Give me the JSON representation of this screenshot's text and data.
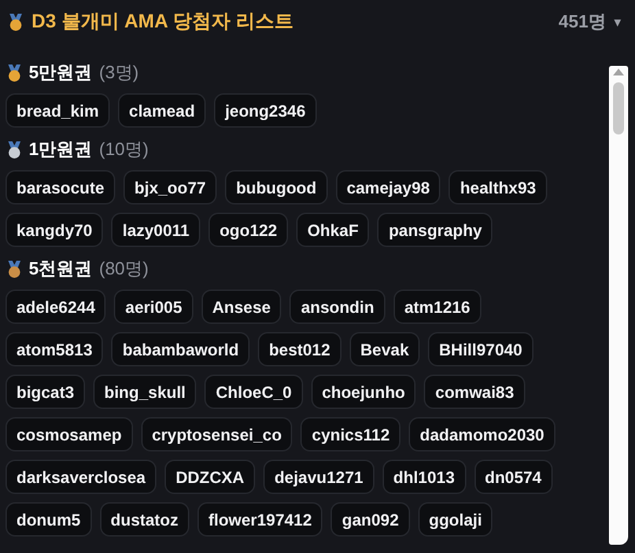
{
  "header": {
    "title": "D3 불개미 AMA 당첨자 리스트",
    "count": "451명",
    "caret": "▾"
  },
  "sections": [
    {
      "title": "5만원권",
      "count": "(3명)",
      "color": "#e5a437",
      "winners": [
        "bread_kim",
        "clamead",
        "jeong2346"
      ]
    },
    {
      "title": "1만원권",
      "count": "(10명)",
      "color": "#c7ccd3",
      "winners": [
        "barasocute",
        "bjx_oo77",
        "bubugood",
        "camejay98",
        "healthx93",
        "kangdy70",
        "lazy0011",
        "ogo122",
        "OhkaF",
        "pansgraphy"
      ]
    },
    {
      "title": "5천원권",
      "count": "(80명)",
      "color": "#c98e47",
      "winners": [
        "adele6244",
        "aeri005",
        "Ansese",
        "ansondin",
        "atm1216",
        "atom5813",
        "babambaworld",
        "best012",
        "Bevak",
        "BHill97040",
        "bigcat3",
        "bing_skull",
        "ChloeC_0",
        "choejunho",
        "comwai83",
        "cosmosamep",
        "cryptosensei_co",
        "cynics112",
        "dadamomo2030",
        "darksaverclosea",
        "DDZCXA",
        "dejavu1271",
        "dhl1013",
        "dn0574",
        "donum5",
        "dustatoz",
        "flower197412",
        "gan092",
        "ggolaji"
      ]
    }
  ]
}
